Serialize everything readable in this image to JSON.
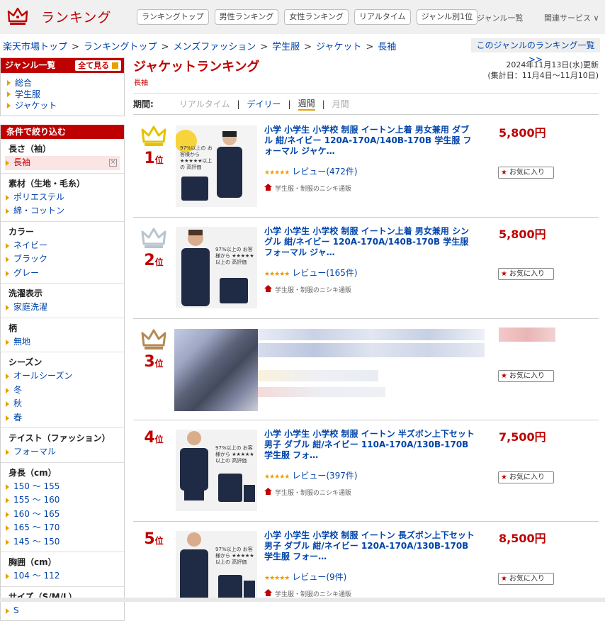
{
  "header": {
    "logo_text": "ランキング",
    "nav": [
      "ランキングトップ",
      "男性ランキング",
      "女性ランキング",
      "リアルタイム",
      "ジャンル別1位"
    ],
    "genre_list": "ジャンル一覧",
    "services": "関連サービス ∨"
  },
  "breadcrumb": [
    "楽天市場トップ",
    "ランキングトップ",
    "メンズファッション",
    "学生服",
    "ジャケット",
    "長袖"
  ],
  "breadcrumb_sep": ">",
  "genre_list_link": "このジャンルのランキング一覧 >>",
  "sidebar": {
    "genre_title": "ジャンル一覧",
    "see_all": "全て見る",
    "genres": [
      "総合",
      "学生服",
      "ジャケット"
    ],
    "filter_title": "条件で絞り込む",
    "sections": [
      {
        "title": "長さ（袖）",
        "items": [
          "長袖"
        ],
        "active": 0
      },
      {
        "title": "素材（生地・毛糸）",
        "items": [
          "ポリエステル",
          "綿・コットン"
        ]
      },
      {
        "title": "カラー",
        "items": [
          "ネイビー",
          "ブラック",
          "グレー"
        ]
      },
      {
        "title": "洗濯表示",
        "items": [
          "家庭洗濯"
        ]
      },
      {
        "title": "柄",
        "items": [
          "無地"
        ]
      },
      {
        "title": "シーズン",
        "items": [
          "オールシーズン",
          "冬",
          "秋",
          "春"
        ]
      },
      {
        "title": "テイスト（ファッション）",
        "items": [
          "フォーマル"
        ]
      },
      {
        "title": "身長（cm）",
        "items": [
          "150 ～ 155",
          "155 ～ 160",
          "160 ～ 165",
          "165 ～ 170",
          "145 ～ 150"
        ]
      },
      {
        "title": "胸囲（cm）",
        "items": [
          "104 ～ 112"
        ]
      },
      {
        "title": "サイズ（S/M/L）",
        "items": [
          "S"
        ]
      }
    ]
  },
  "main": {
    "title": "ジャケットランキング",
    "subtitle": "長袖",
    "updated_line1": "2024年11月13日(水)更新",
    "updated_line2": "(集計日：11月4日～11月10日)",
    "period_label": "期間:",
    "period_options": [
      "リアルタイム",
      "デイリー",
      "週間",
      "月間"
    ],
    "period_selected": "週間",
    "items": [
      {
        "rank": "1",
        "rank_suffix": "位",
        "title": "小学 小学生 小学校 制服 イートン上着 男女兼用 ダブル 紺/ネイビー 120A-170A/140B-170B 学生服 フォーマル ジャケ…",
        "rating": "★★★★★",
        "reviews": "レビュー(472件)",
        "shop": "学生服・制服のニシキ通販",
        "price": "5,800円",
        "fav": "お気に入り",
        "thumb_badge": "97%以上の お客様から ★★★★★以上の 高評価"
      },
      {
        "rank": "2",
        "rank_suffix": "位",
        "title": "小学 小学生 小学校 制服 イートン上着 男女兼用 シングル 紺/ネイビー 120A-170A/140B-170B 学生服 フォーマル ジャ…",
        "rating": "★★★★★",
        "reviews": "レビュー(165件)",
        "shop": "学生服・制服のニシキ通販",
        "price": "5,800円",
        "fav": "お気に入り",
        "thumb_badge": "97%以上の お客様から ★★★★★以上の 高評価"
      },
      {
        "rank": "3",
        "rank_suffix": "位",
        "fav": "お気に入り"
      },
      {
        "rank": "4",
        "rank_suffix": "位",
        "title": "小学 小学生 小学校 制服 イートン 半ズボン上下セット 男子 ダブル 紺/ネイビー 110A-170A/130B-170B 学生服 フォ…",
        "rating": "★★★★★",
        "reviews": "レビュー(397件)",
        "shop": "学生服・制服のニシキ通販",
        "price": "7,500円",
        "fav": "お気に入り",
        "thumb_badge": "97%以上の お客様から ★★★★★以上の 高評価"
      },
      {
        "rank": "5",
        "rank_suffix": "位",
        "title": "小学 小学生 小学校 制服 イートン 長ズボン上下セット 男子 ダブル 紺/ネイビー 120A-170A/130B-170B 学生服 フォー…",
        "rating": "★★★★★",
        "reviews": "レビュー(9件)",
        "shop": "学生服・制服のニシキ通販",
        "price": "8,500円",
        "fav": "お気に入り",
        "thumb_badge": "97%以上の お客様から ★★★★★以上の 高評価"
      }
    ]
  },
  "colors": {
    "brand": "#bf0000",
    "link": "#0044aa",
    "star": "#e6a000",
    "gold": "#e6c200",
    "silver": "#b8c4cf",
    "bronze": "#b48a52"
  }
}
